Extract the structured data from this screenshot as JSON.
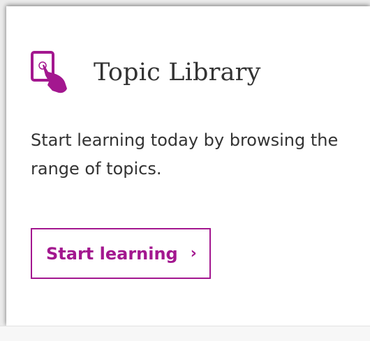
{
  "card": {
    "title": "Topic Library",
    "description": "Start learning today by browsing the range of topics.",
    "button_label": "Start learning",
    "button_chevron": "›",
    "icon": "tablet-touch-icon"
  },
  "colors": {
    "accent": "#a3178f",
    "text": "#333333",
    "card_background": "#ffffff",
    "page_background": "#ebebeb"
  }
}
